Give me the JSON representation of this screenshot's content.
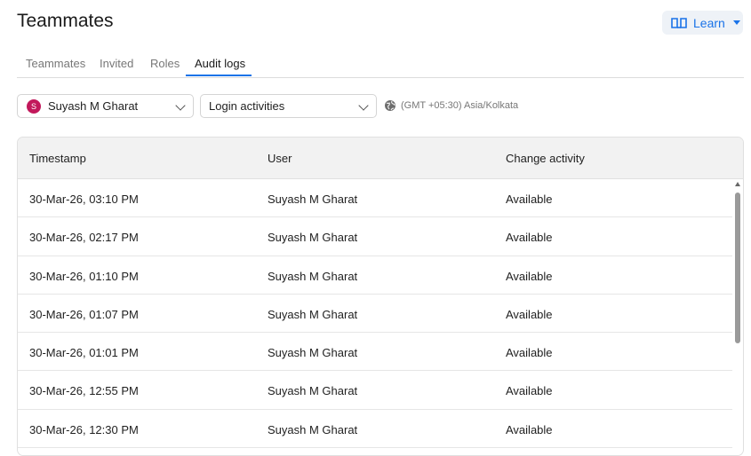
{
  "header": {
    "title": "Teammates",
    "learn_label": "Learn"
  },
  "tabs": [
    {
      "label": "Teammates"
    },
    {
      "label": "Invited"
    },
    {
      "label": "Roles"
    },
    {
      "label": "Audit logs",
      "active": true
    }
  ],
  "filters": {
    "user_initial": "S",
    "user_name": "Suyash M Gharat",
    "activity": "Login activities",
    "timezone": "(GMT +05:30) Asia/Kolkata"
  },
  "table": {
    "headers": [
      "Timestamp",
      "User",
      "Change activity"
    ],
    "rows": [
      [
        "30-Mar-26, 03:10 PM",
        "Suyash M Gharat",
        "Available"
      ],
      [
        "30-Mar-26, 02:17 PM",
        "Suyash M Gharat",
        "Available"
      ],
      [
        "30-Mar-26, 01:10 PM",
        "Suyash M Gharat",
        "Available"
      ],
      [
        "30-Mar-26, 01:07 PM",
        "Suyash M Gharat",
        "Available"
      ],
      [
        "30-Mar-26, 01:01 PM",
        "Suyash M Gharat",
        "Available"
      ],
      [
        "30-Mar-26, 12:55 PM",
        "Suyash M Gharat",
        "Available"
      ],
      [
        "30-Mar-26, 12:30 PM",
        "Suyash M Gharat",
        "Available"
      ]
    ]
  },
  "colors": {
    "accent": "#1a73e8",
    "avatar": "#c2185b"
  },
  "icons": {
    "learn": "book-icon",
    "timezone": "globe-icon",
    "dropdown": "chevron-down-icon"
  }
}
